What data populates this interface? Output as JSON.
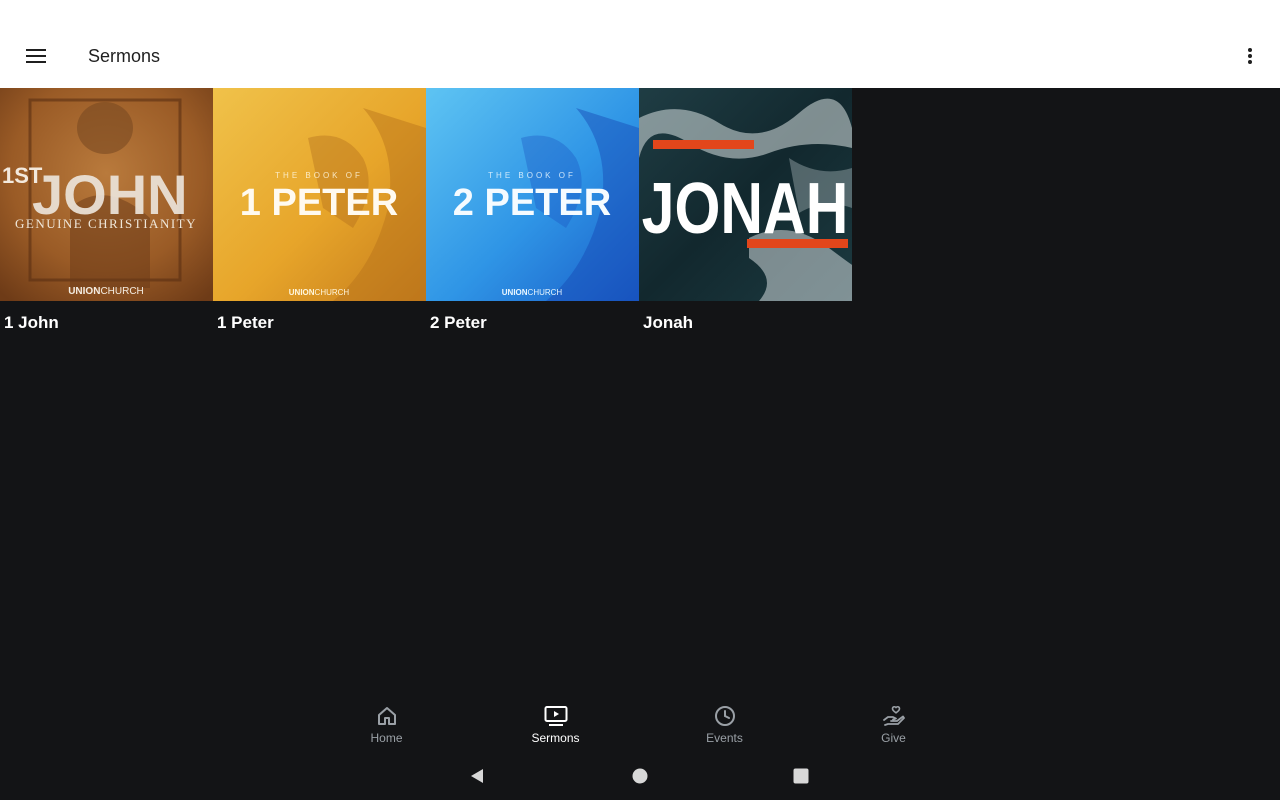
{
  "appbar": {
    "title": "Sermons"
  },
  "icons": {
    "menu": "hamburger-menu-icon",
    "overflow": "more-vert-icon"
  },
  "series": [
    {
      "title": "1 John",
      "art": {
        "prefix": "1ST",
        "main": "JOHN",
        "subtitle": "GENUINE CHRISTIANITY",
        "brand_bold": "UNION",
        "brand_light": "CHURCH"
      }
    },
    {
      "title": "1 Peter",
      "art": {
        "kicker": "THE BOOK OF",
        "main": "1 PETER",
        "brand_bold": "UNION",
        "brand_light": "CHURCH"
      }
    },
    {
      "title": "2 Peter",
      "art": {
        "kicker": "THE BOOK OF",
        "main": "2 PETER",
        "brand_bold": "UNION",
        "brand_light": "CHURCH"
      }
    },
    {
      "title": "Jonah",
      "art": {
        "main": "JONAH"
      }
    }
  ],
  "bottom_nav": {
    "items": [
      {
        "label": "Home",
        "icon": "home-icon",
        "active": false
      },
      {
        "label": "Sermons",
        "icon": "video-library-icon",
        "active": true
      },
      {
        "label": "Events",
        "icon": "clock-icon",
        "active": false
      },
      {
        "label": "Give",
        "icon": "hand-heart-icon",
        "active": false
      }
    ]
  },
  "system_nav": {
    "back": "back-icon",
    "home": "home-circle-icon",
    "recents": "recents-icon"
  },
  "colors": {
    "background": "#131416",
    "appbar": "#ffffff",
    "accent_orange": "#e2461b",
    "inactive_nav": "#9aa0a6"
  }
}
